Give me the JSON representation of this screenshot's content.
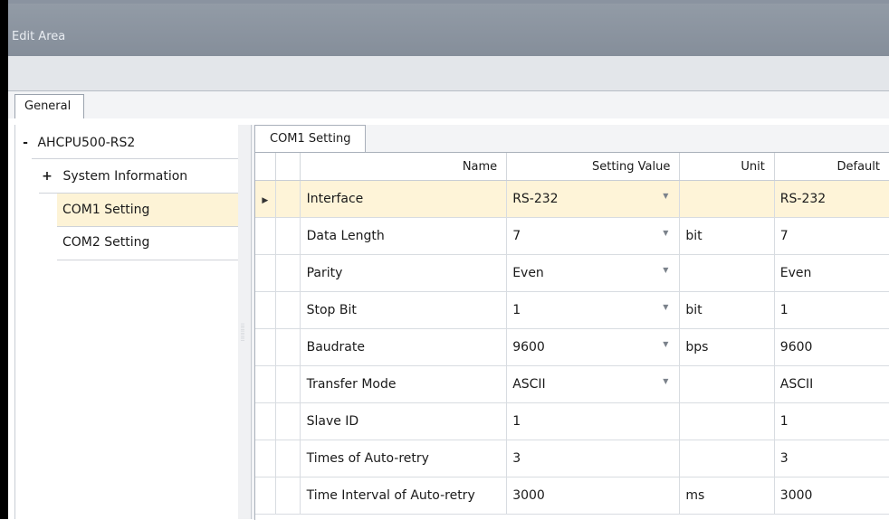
{
  "window": {
    "title": "Edit Area"
  },
  "tabs": {
    "general": "General"
  },
  "tree": {
    "root": {
      "expander": "-",
      "label": "AHCPU500-RS2"
    },
    "items": [
      {
        "expander": "+",
        "label": "System Information"
      },
      {
        "expander": "",
        "label": "COM1 Setting"
      },
      {
        "expander": "",
        "label": "COM2 Setting"
      }
    ]
  },
  "settings_tab": "COM1 Setting",
  "grid": {
    "columns": [
      "Name",
      "Setting Value",
      "Unit",
      "Default"
    ],
    "rows": [
      {
        "name": "Interface",
        "value": "RS-232",
        "dropdown": true,
        "unit": "",
        "default": "RS-232",
        "selected": true
      },
      {
        "name": "Data Length",
        "value": "7",
        "dropdown": true,
        "unit": "bit",
        "default": "7"
      },
      {
        "name": "Parity",
        "value": "Even",
        "dropdown": true,
        "unit": "",
        "default": "Even"
      },
      {
        "name": "Stop Bit",
        "value": "1",
        "dropdown": true,
        "unit": "bit",
        "default": "1"
      },
      {
        "name": "Baudrate",
        "value": "9600",
        "dropdown": true,
        "unit": "bps",
        "default": "9600"
      },
      {
        "name": "Transfer Mode",
        "value": "ASCII",
        "dropdown": true,
        "unit": "",
        "default": "ASCII"
      },
      {
        "name": "Slave ID",
        "value": "1",
        "dropdown": false,
        "unit": "",
        "default": "1"
      },
      {
        "name": "Times of Auto-retry",
        "value": "3",
        "dropdown": false,
        "unit": "",
        "default": "3"
      },
      {
        "name": "Time Interval of Auto-retry",
        "value": "3000",
        "dropdown": false,
        "unit": "ms",
        "default": "3000"
      }
    ]
  },
  "colors": {
    "selection": "#fef4d8",
    "titlebar": "#8a93a0"
  }
}
